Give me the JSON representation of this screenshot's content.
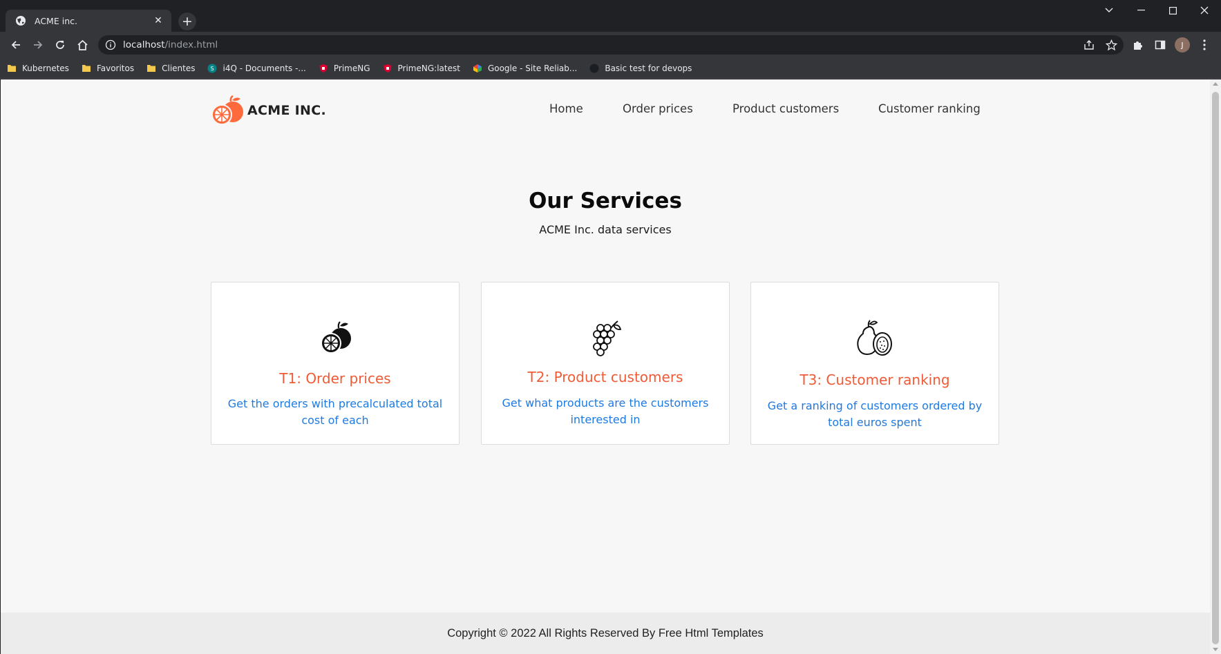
{
  "browser": {
    "tab_title": "ACME inc.",
    "new_tab_label": "+",
    "url_host": "localhost",
    "url_path": "/index.html",
    "profile_initial": "J",
    "bookmarks": [
      {
        "label": "Kubernetes",
        "icon": "folder-icon"
      },
      {
        "label": "Favoritos",
        "icon": "folder-icon"
      },
      {
        "label": "Clientes",
        "icon": "folder-icon"
      },
      {
        "label": "i4Q - Documents -...",
        "icon": "sharepoint-icon"
      },
      {
        "label": "PrimeNG",
        "icon": "prime-shield-icon"
      },
      {
        "label": "PrimeNG:latest",
        "icon": "prime-shield-icon"
      },
      {
        "label": "Google - Site Reliab...",
        "icon": "google-icon"
      },
      {
        "label": "Basic test for devops",
        "icon": "github-icon"
      }
    ]
  },
  "page": {
    "brand": "ACME INC.",
    "nav": [
      "Home",
      "Order prices",
      "Product customers",
      "Customer ranking"
    ],
    "heading": "Our Services",
    "subheading": "ACME Inc. data services",
    "cards": [
      {
        "icon": "orange-icon",
        "title": "T1: Order prices",
        "desc": "Get the orders with precalculated total cost of each"
      },
      {
        "icon": "grapes-icon",
        "title": "T2: Product customers",
        "desc": "Get what products are the customers interested in"
      },
      {
        "icon": "guava-icon",
        "title": "T3: Customer ranking",
        "desc": "Get a ranking of customers ordered by total euros spent"
      }
    ],
    "footer": "Copyright © 2022 All Rights Reserved By Free Html Templates"
  },
  "colors": {
    "accent": "#f05a35",
    "link": "#1f7ae0",
    "chrome_dark": "#202124",
    "chrome_toolbar": "#35363a"
  }
}
